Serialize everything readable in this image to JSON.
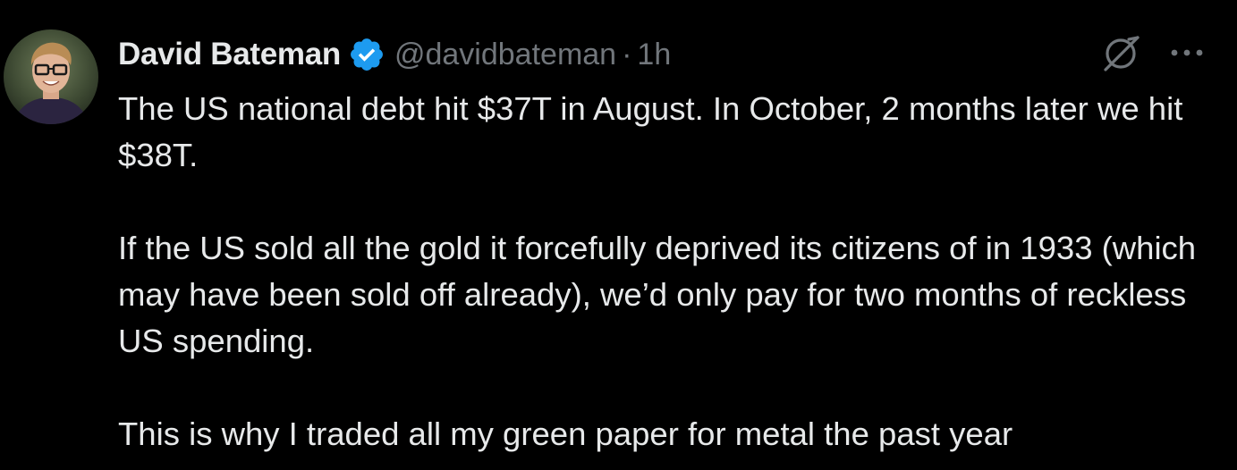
{
  "author": {
    "name": "David Bateman",
    "handle": "@davidbateman",
    "separator": "·",
    "time": "1h",
    "verified": true,
    "verified_color": "#1d9bf0"
  },
  "icons": {
    "verified": "verified-badge-icon",
    "grok": "grok-icon",
    "more": "more-options-icon"
  },
  "tweet": {
    "paragraphs": [
      "The US national debt hit $37T in August. In October, 2 months later we hit $38T.",
      "If the US sold all the gold it forcefully deprived its citizens of in 1933 (which may have been sold off already), we’d only pay for two months of reckless US spending.",
      "This is why I traded all my green paper for metal the past year"
    ]
  },
  "colors": {
    "background": "#000000",
    "text_primary": "#e7e9ea",
    "text_secondary": "#71767b"
  }
}
